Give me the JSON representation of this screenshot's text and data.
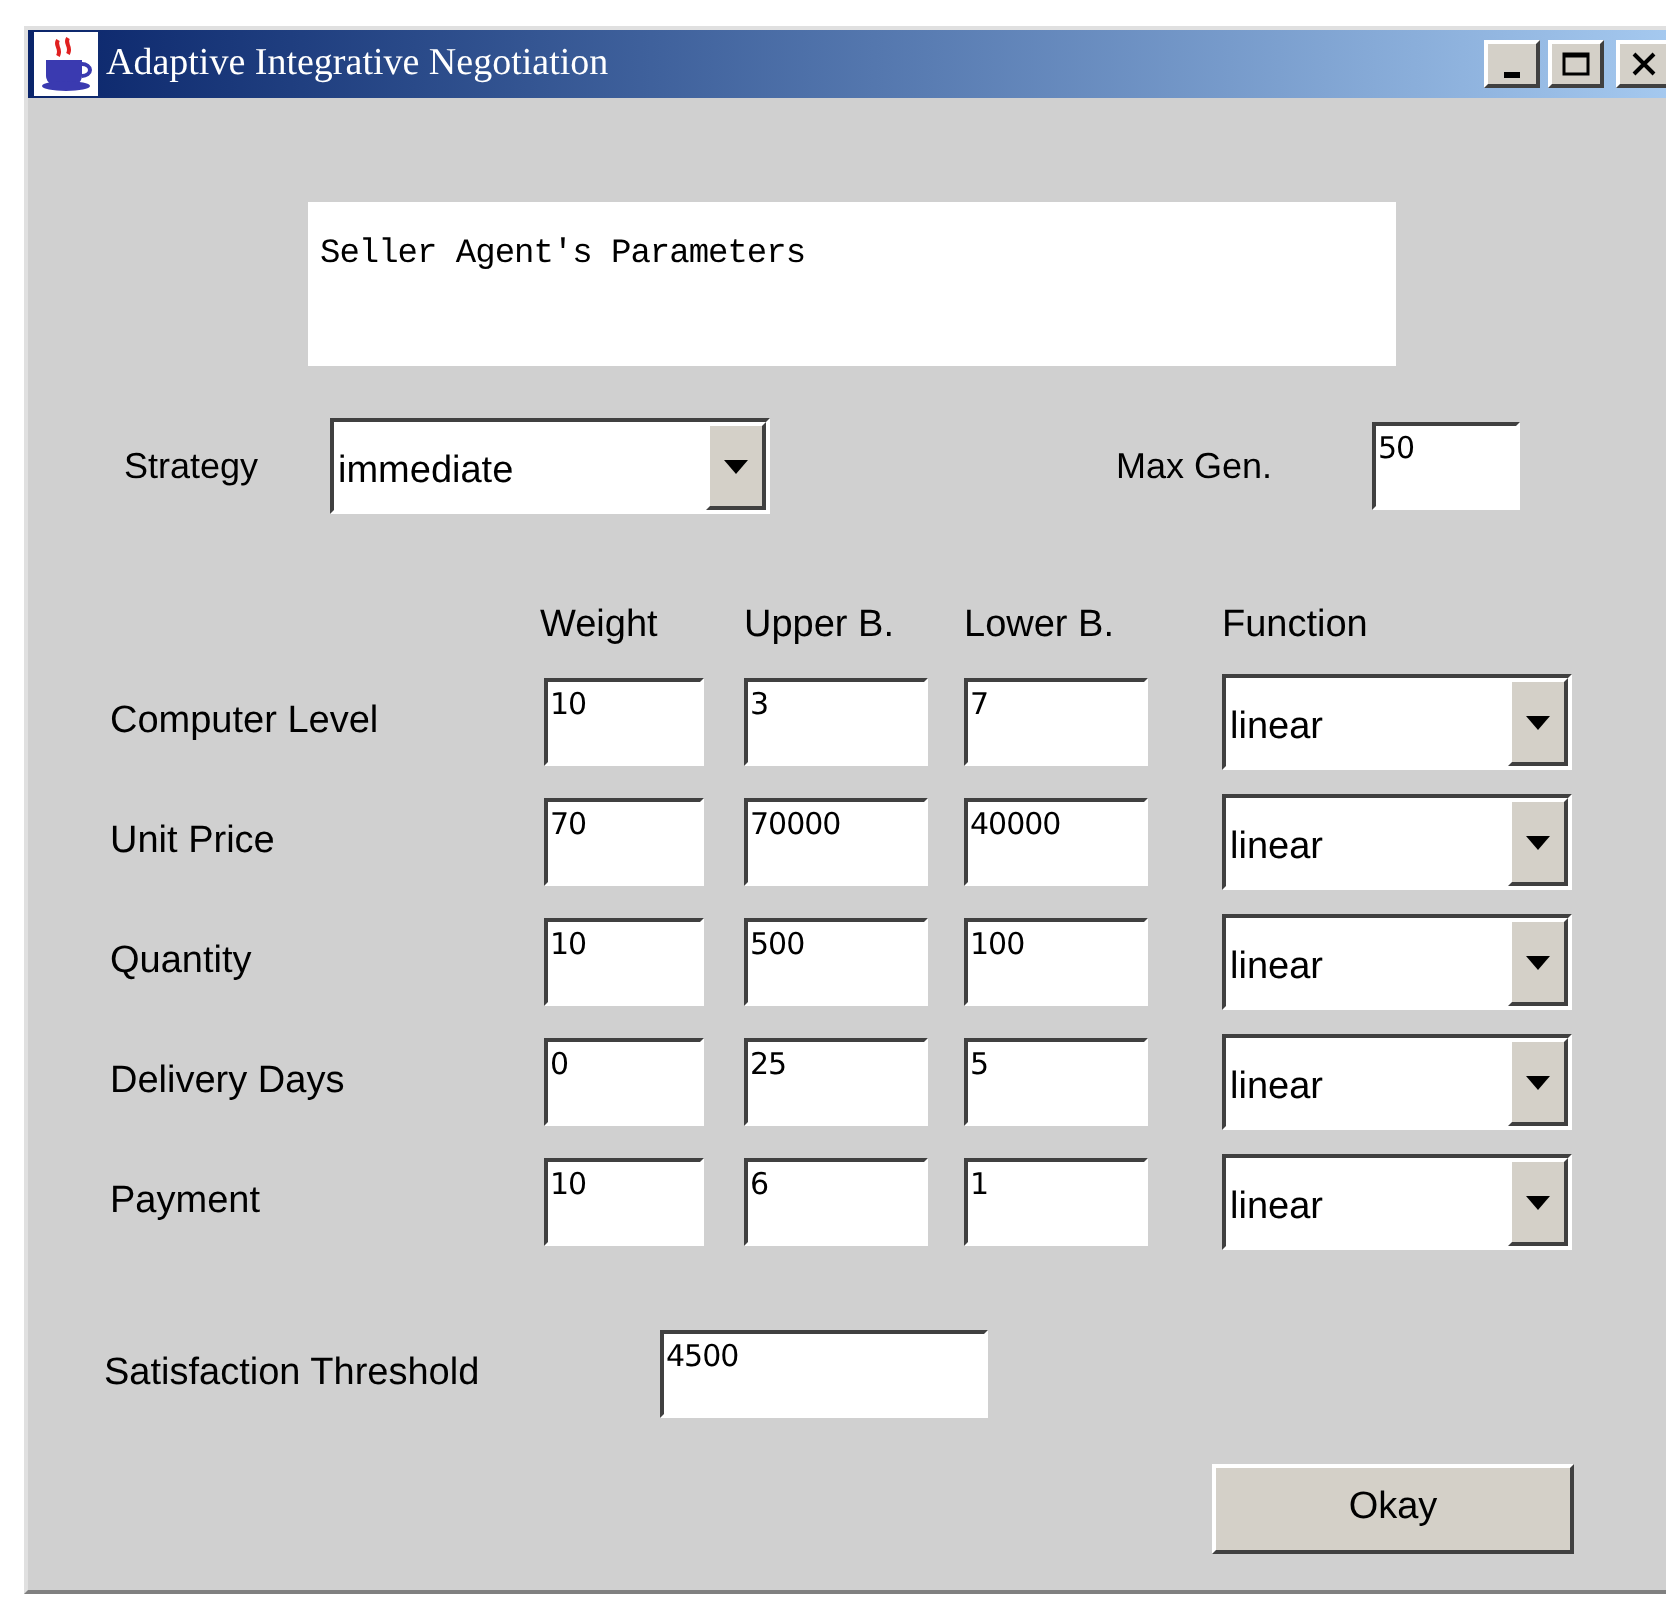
{
  "window": {
    "title": "Adaptive Integrative Negotiation"
  },
  "heading": "Seller Agent's Parameters",
  "strategy": {
    "label": "Strategy",
    "value": "immediate"
  },
  "max_gen": {
    "label": "Max Gen.",
    "value": "50"
  },
  "columns": [
    "Weight",
    "Upper B.",
    "Lower B.",
    "Function"
  ],
  "rows": [
    {
      "label": "Computer Level",
      "weight": "10",
      "upper": "3",
      "lower": "7",
      "function": "linear"
    },
    {
      "label": "Unit Price",
      "weight": "70",
      "upper": "70000",
      "lower": "40000",
      "function": "linear"
    },
    {
      "label": "Quantity",
      "weight": "10",
      "upper": "500",
      "lower": "100",
      "function": "linear"
    },
    {
      "label": "Delivery Days",
      "weight": "0",
      "upper": "25",
      "lower": "5",
      "function": "linear"
    },
    {
      "label": "Payment",
      "weight": "10",
      "upper": "6",
      "lower": "1",
      "function": "linear"
    }
  ],
  "threshold": {
    "label": "Satisfaction Threshold",
    "value": "4500"
  },
  "buttons": [
    "Okay"
  ]
}
